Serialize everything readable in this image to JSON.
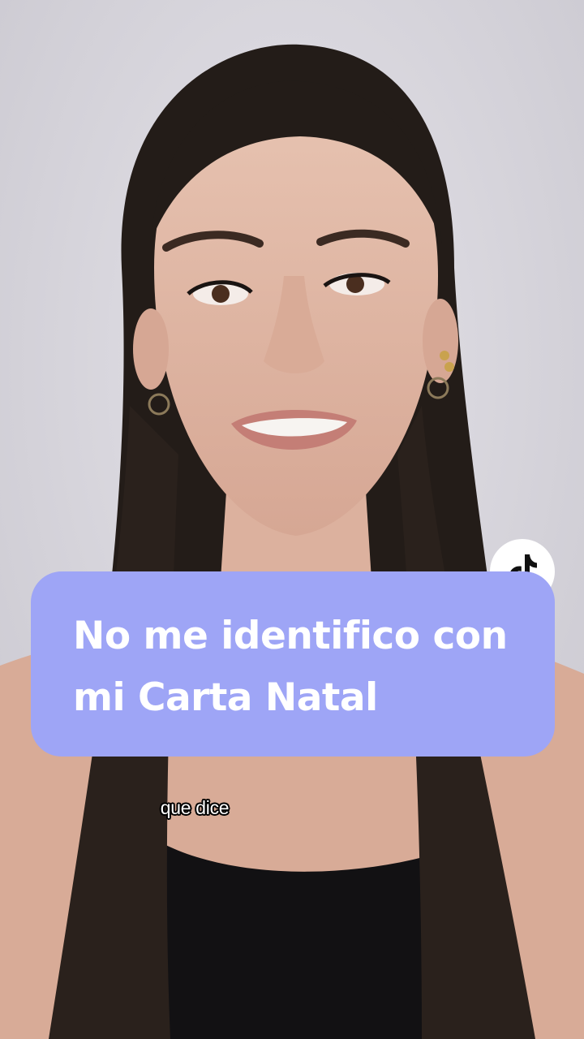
{
  "video": {
    "scene_description_icon": "person-video-frame",
    "background_color": "#d9d7de",
    "card_color": "#9ea5f6"
  },
  "title_card": {
    "line1": "No me identifico con",
    "line2": "mi Carta Natal"
  },
  "badge": {
    "icon": "tiktok-logo-icon"
  },
  "caption": {
    "text": "que dice"
  }
}
